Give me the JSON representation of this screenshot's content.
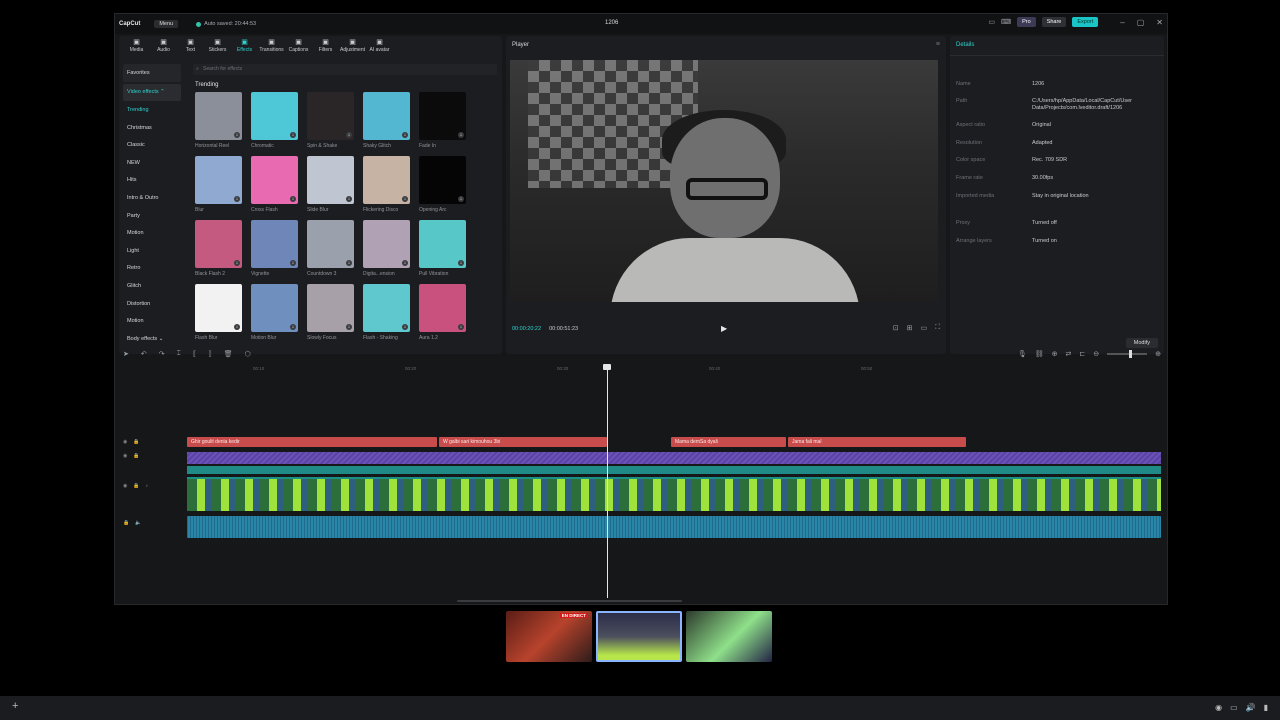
{
  "app": {
    "logo": "CapCut",
    "menu": "Menu",
    "autosave": "Auto saved: 20:44:53",
    "project_title": "1206",
    "pro": "Pro",
    "share": "Share",
    "export": "Export"
  },
  "toolbar": [
    {
      "label": "Media",
      "icon": "media-icon"
    },
    {
      "label": "Audio",
      "icon": "audio-icon"
    },
    {
      "label": "Text",
      "icon": "text-icon"
    },
    {
      "label": "Stickers",
      "icon": "sticker-icon"
    },
    {
      "label": "Effects",
      "icon": "effects-icon",
      "active": true
    },
    {
      "label": "Transitions",
      "icon": "transitions-icon"
    },
    {
      "label": "Captions",
      "icon": "captions-icon"
    },
    {
      "label": "Filters",
      "icon": "filters-icon"
    },
    {
      "label": "Adjustment",
      "icon": "adjustment-icon"
    },
    {
      "label": "AI avatar",
      "icon": "ai-avatar-icon"
    }
  ],
  "categories": {
    "favorites": "Favorites",
    "video_effects": "Video effects",
    "items": [
      "Trending",
      "Christmas",
      "Classic",
      "NEW",
      "Hits",
      "Intro & Outro",
      "Party",
      "Motion",
      "Light",
      "Retro",
      "Glitch",
      "Distortion",
      "Motion"
    ],
    "body_effects": "Body effects"
  },
  "search_placeholder": "Search for effects",
  "trending_heading": "Trending",
  "effects": [
    {
      "label": "Horizontal Reel",
      "color": "#8a8f99"
    },
    {
      "label": "Chromatic",
      "color": "#4ec7d6"
    },
    {
      "label": "Spin & Shake",
      "color": "#2a2526"
    },
    {
      "label": "Shaky Glitch",
      "color": "#53b7d2"
    },
    {
      "label": "Fade In",
      "color": "#0b0b0b"
    },
    {
      "label": "Blur",
      "color": "#8fa9d1"
    },
    {
      "label": "Cross Flash",
      "color": "#e86ab0"
    },
    {
      "label": "Slide Blur",
      "color": "#bfc6d2"
    },
    {
      "label": "Flickering Disco",
      "color": "#c7b3a4"
    },
    {
      "label": "Opening Arc",
      "color": "#050505"
    },
    {
      "label": "Black Flash 2",
      "color": "#c45a80"
    },
    {
      "label": "Vignette",
      "color": "#6f87b8"
    },
    {
      "label": "Countdown 3",
      "color": "#9aa1ad"
    },
    {
      "label": "Digita...ension",
      "color": "#b0a2b4"
    },
    {
      "label": "Pull Vibration",
      "color": "#58c7c7"
    },
    {
      "label": "Flash Blur",
      "color": "#f2f2f2"
    },
    {
      "label": "Motion Blur",
      "color": "#6f8fbf"
    },
    {
      "label": "Slowly Focus",
      "color": "#a7a0a9"
    },
    {
      "label": "Flash - Shaking",
      "color": "#5fc8cf"
    },
    {
      "label": "Aura 1.2",
      "color": "#c9517d"
    }
  ],
  "player": {
    "heading": "Player",
    "current_time": "00:00:20:22",
    "total_time": "00:00:51:23"
  },
  "details": {
    "heading": "Details",
    "rows": [
      {
        "key": "Name",
        "value": "1206"
      },
      {
        "key": "Path",
        "value": "C:/Users/hp/AppData/Local/CapCut/User Data/Projects/com.lveditor.draft/1206"
      },
      {
        "key": "Aspect ratio",
        "value": "Original"
      },
      {
        "key": "Resolution",
        "value": "Adapted"
      },
      {
        "key": "Color space",
        "value": "Rec. 709 SDR"
      },
      {
        "key": "Frame rate",
        "value": "30.00fps"
      },
      {
        "key": "Imported media",
        "value": "Stay in original location"
      },
      {
        "key": "Proxy",
        "value": "Turned off"
      },
      {
        "key": "Arrange layers",
        "value": "Turned on"
      }
    ],
    "modify": "Modify"
  },
  "ruler": [
    "00:10",
    "00:20",
    "00:30",
    "00:40",
    "00:50"
  ],
  "clips": [
    {
      "label": "Ghir goulit denia kedir",
      "start": 0,
      "width": 250
    },
    {
      "label": "W galbi sari kimouhou 3bi",
      "start": 252,
      "width": 168
    },
    {
      "label": "Mama demSa dyali",
      "start": 484,
      "width": 115
    },
    {
      "label": "Jama fali mal",
      "start": 601,
      "width": 178
    }
  ],
  "thumbnails": [
    {
      "live": "EN DIRECT"
    }
  ]
}
